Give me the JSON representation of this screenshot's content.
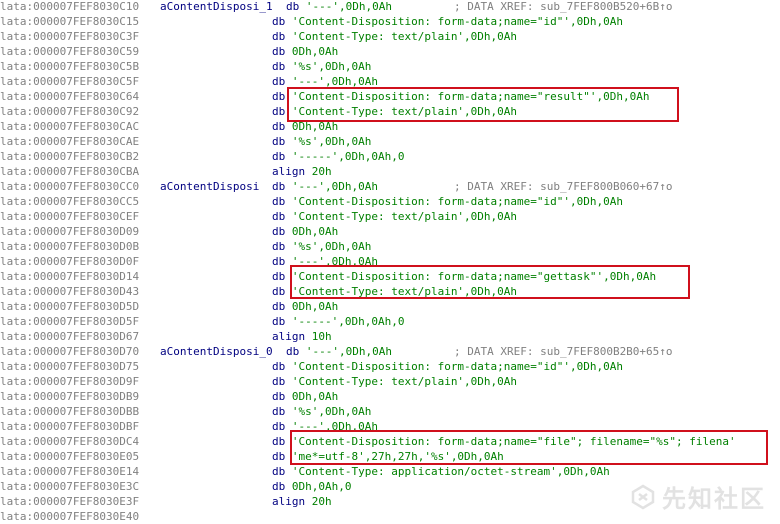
{
  "listing": {
    "rows": [
      {
        "addr": "lata:000007FEF8030C10",
        "name": "aContentDisposi_1",
        "dir": "db",
        "ops": " '---',0Dh,0Ah",
        "cmt": "; DATA XREF: sub_7FEF800B520+6B↑o"
      },
      {
        "addr": "lata:000007FEF8030C15",
        "name": "",
        "dir": "db",
        "ops": " 'Content-Disposition: form-data;name=\"id\"',0Dh,0Ah",
        "cmt": ""
      },
      {
        "addr": "lata:000007FEF8030C3F",
        "name": "",
        "dir": "db",
        "ops": " 'Content-Type: text/plain',0Dh,0Ah",
        "cmt": ""
      },
      {
        "addr": "lata:000007FEF8030C59",
        "name": "",
        "dir": "db",
        "ops": " 0Dh,0Ah",
        "cmt": ""
      },
      {
        "addr": "lata:000007FEF8030C5B",
        "name": "",
        "dir": "db",
        "ops": " '%s',0Dh,0Ah",
        "cmt": ""
      },
      {
        "addr": "lata:000007FEF8030C5F",
        "name": "",
        "dir": "db",
        "ops": " '---',0Dh,0Ah",
        "cmt": ""
      },
      {
        "addr": "lata:000007FEF8030C64",
        "name": "",
        "dir": "db",
        "ops": " 'Content-Disposition: form-data;name=\"result\"',0Dh,0Ah",
        "cmt": ""
      },
      {
        "addr": "lata:000007FEF8030C92",
        "name": "",
        "dir": "db",
        "ops": " 'Content-Type: text/plain',0Dh,0Ah",
        "cmt": ""
      },
      {
        "addr": "lata:000007FEF8030CAC",
        "name": "",
        "dir": "db",
        "ops": " 0Dh,0Ah",
        "cmt": ""
      },
      {
        "addr": "lata:000007FEF8030CAE",
        "name": "",
        "dir": "db",
        "ops": " '%s',0Dh,0Ah",
        "cmt": ""
      },
      {
        "addr": "lata:000007FEF8030CB2",
        "name": "",
        "dir": "db",
        "ops": " '-----',0Dh,0Ah,0",
        "cmt": ""
      },
      {
        "addr": "lata:000007FEF8030CBA",
        "name": "",
        "dir": "align",
        "ops": " 20h",
        "cmt": ""
      },
      {
        "addr": "lata:000007FEF8030CC0",
        "name": "aContentDisposi",
        "dir": "db",
        "ops": " '---',0Dh,0Ah",
        "cmt": "; DATA XREF: sub_7FEF800B060+67↑o"
      },
      {
        "addr": "lata:000007FEF8030CC5",
        "name": "",
        "dir": "db",
        "ops": " 'Content-Disposition: form-data;name=\"id\"',0Dh,0Ah",
        "cmt": ""
      },
      {
        "addr": "lata:000007FEF8030CEF",
        "name": "",
        "dir": "db",
        "ops": " 'Content-Type: text/plain',0Dh,0Ah",
        "cmt": ""
      },
      {
        "addr": "lata:000007FEF8030D09",
        "name": "",
        "dir": "db",
        "ops": " 0Dh,0Ah",
        "cmt": ""
      },
      {
        "addr": "lata:000007FEF8030D0B",
        "name": "",
        "dir": "db",
        "ops": " '%s',0Dh,0Ah",
        "cmt": ""
      },
      {
        "addr": "lata:000007FEF8030D0F",
        "name": "",
        "dir": "db",
        "ops": " '---',0Dh,0Ah",
        "cmt": ""
      },
      {
        "addr": "lata:000007FEF8030D14",
        "name": "",
        "dir": "db",
        "ops": " 'Content-Disposition: form-data;name=\"gettask\"',0Dh,0Ah",
        "cmt": ""
      },
      {
        "addr": "lata:000007FEF8030D43",
        "name": "",
        "dir": "db",
        "ops": " 'Content-Type: text/plain',0Dh,0Ah",
        "cmt": ""
      },
      {
        "addr": "lata:000007FEF8030D5D",
        "name": "",
        "dir": "db",
        "ops": " 0Dh,0Ah",
        "cmt": ""
      },
      {
        "addr": "lata:000007FEF8030D5F",
        "name": "",
        "dir": "db",
        "ops": " '-----',0Dh,0Ah,0",
        "cmt": ""
      },
      {
        "addr": "lata:000007FEF8030D67",
        "name": "",
        "dir": "align",
        "ops": " 10h",
        "cmt": ""
      },
      {
        "addr": "lata:000007FEF8030D70",
        "name": "aContentDisposi_0",
        "dir": "db",
        "ops": " '---',0Dh,0Ah",
        "cmt": "; DATA XREF: sub_7FEF800B2B0+65↑o"
      },
      {
        "addr": "lata:000007FEF8030D75",
        "name": "",
        "dir": "db",
        "ops": " 'Content-Disposition: form-data;name=\"id\"',0Dh,0Ah",
        "cmt": ""
      },
      {
        "addr": "lata:000007FEF8030D9F",
        "name": "",
        "dir": "db",
        "ops": " 'Content-Type: text/plain',0Dh,0Ah",
        "cmt": ""
      },
      {
        "addr": "lata:000007FEF8030DB9",
        "name": "",
        "dir": "db",
        "ops": " 0Dh,0Ah",
        "cmt": ""
      },
      {
        "addr": "lata:000007FEF8030DBB",
        "name": "",
        "dir": "db",
        "ops": " '%s',0Dh,0Ah",
        "cmt": ""
      },
      {
        "addr": "lata:000007FEF8030DBF",
        "name": "",
        "dir": "db",
        "ops": " '---',0Dh,0Ah",
        "cmt": ""
      },
      {
        "addr": "lata:000007FEF8030DC4",
        "name": "",
        "dir": "db",
        "ops": " 'Content-Disposition: form-data;name=\"file\"; filename=\"%s\"; filena'",
        "cmt": ""
      },
      {
        "addr": "lata:000007FEF8030E05",
        "name": "",
        "dir": "db",
        "ops": " 'me*=utf-8',27h,27h,'%s',0Dh,0Ah",
        "cmt": ""
      },
      {
        "addr": "lata:000007FEF8030E14",
        "name": "",
        "dir": "db",
        "ops": " 'Content-Type: application/octet-stream',0Dh,0Ah",
        "cmt": ""
      },
      {
        "addr": "lata:000007FEF8030E3C",
        "name": "",
        "dir": "db",
        "ops": " 0Dh,0Ah,0",
        "cmt": ""
      },
      {
        "addr": "lata:000007FEF8030E3F",
        "name": "",
        "dir": "align",
        "ops": " 20h",
        "cmt": ""
      },
      {
        "addr": "lata:000007FEF8030E40",
        "name": "",
        "dir": "",
        "ops": "",
        "cmt": ""
      }
    ]
  },
  "colors": {
    "address": "#808080",
    "name": "#000080",
    "directive": "#000080",
    "operand": "#008000",
    "comment": "#808080",
    "highlight_box": "#d0101c"
  },
  "watermark": {
    "icon": "xianzhi-logo-icon",
    "text": "先知社区"
  }
}
